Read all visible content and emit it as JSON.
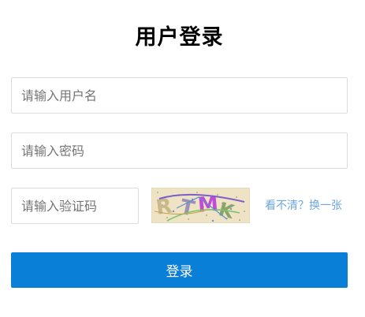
{
  "form": {
    "title": "用户登录",
    "username_placeholder": "请输入用户名",
    "password_placeholder": "请输入密码",
    "captcha_placeholder": "请输入验证码",
    "captcha_text": "R TMK",
    "refresh_link": "看不清？换一张",
    "login_button": "登录"
  },
  "colors": {
    "primary_button": "#0a7fd8",
    "link": "#6ea6e0",
    "border": "#dcdcdc"
  }
}
